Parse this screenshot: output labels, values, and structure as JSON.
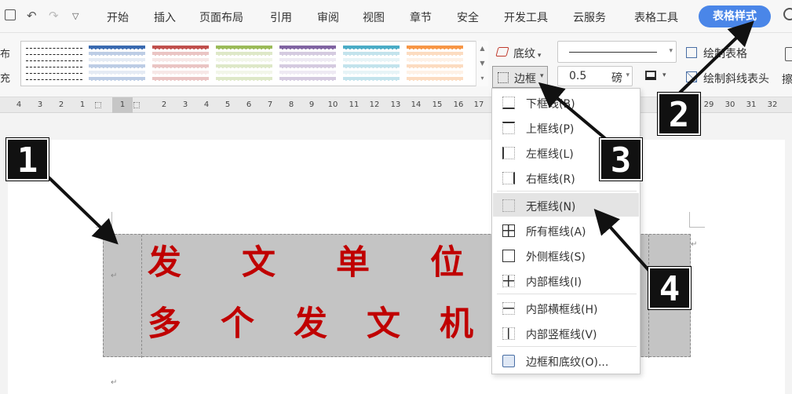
{
  "menu_tabs": [
    "开始",
    "插入",
    "页面布局",
    "引用",
    "审阅",
    "视图",
    "章节",
    "安全",
    "开发工具",
    "云服务",
    "表格工具"
  ],
  "active_tab": "表格样式",
  "ribbon": {
    "side_glyphs": [
      "布",
      "充"
    ],
    "shading_label": "底纹",
    "border_label": "边框",
    "line_weight_value": "0.5",
    "line_weight_unit": "磅",
    "draw_table_label": "绘制表格",
    "draw_diagonal_label": "绘制斜线表头",
    "eraser_label": "擦"
  },
  "style_colors": [
    "#222222",
    "#3a6ab0",
    "#c0504d",
    "#9bbb59",
    "#8064a2",
    "#4bacc6",
    "#f79646"
  ],
  "ruler_ticks": [
    "4",
    "3",
    "2",
    "1",
    "1",
    "2",
    "3",
    "4",
    "5",
    "6",
    "7",
    "8",
    "9",
    "10",
    "11",
    "12",
    "13",
    "14",
    "15",
    "16",
    "17",
    "18",
    "29",
    "30",
    "31",
    "32"
  ],
  "document": {
    "line1": [
      "发",
      "文",
      "单",
      "位"
    ],
    "line2": [
      "多",
      "个",
      "发",
      "文",
      "机"
    ],
    "paragraph_mark": "↵"
  },
  "border_menu": {
    "items": [
      {
        "label": "下框线(B)",
        "icon": "bottom-border-icon"
      },
      {
        "label": "上框线(P)",
        "icon": "top-border-icon"
      },
      {
        "label": "左框线(L)",
        "icon": "left-border-icon"
      },
      {
        "label": "右框线(R)",
        "icon": "right-border-icon"
      },
      {
        "label": "无框线(N)",
        "icon": "no-border-icon"
      },
      {
        "label": "所有框线(A)",
        "icon": "all-borders-icon"
      },
      {
        "label": "外侧框线(S)",
        "icon": "outside-borders-icon"
      },
      {
        "label": "内部框线(I)",
        "icon": "inside-borders-icon"
      },
      {
        "label": "内部横框线(H)",
        "icon": "inside-horizontal-border-icon"
      },
      {
        "label": "内部竖框线(V)",
        "icon": "inside-vertical-border-icon"
      },
      {
        "label": "边框和底纹(O)...",
        "icon": "borders-and-shading-icon"
      }
    ]
  },
  "callouts": [
    "1",
    "2",
    "3",
    "4"
  ]
}
